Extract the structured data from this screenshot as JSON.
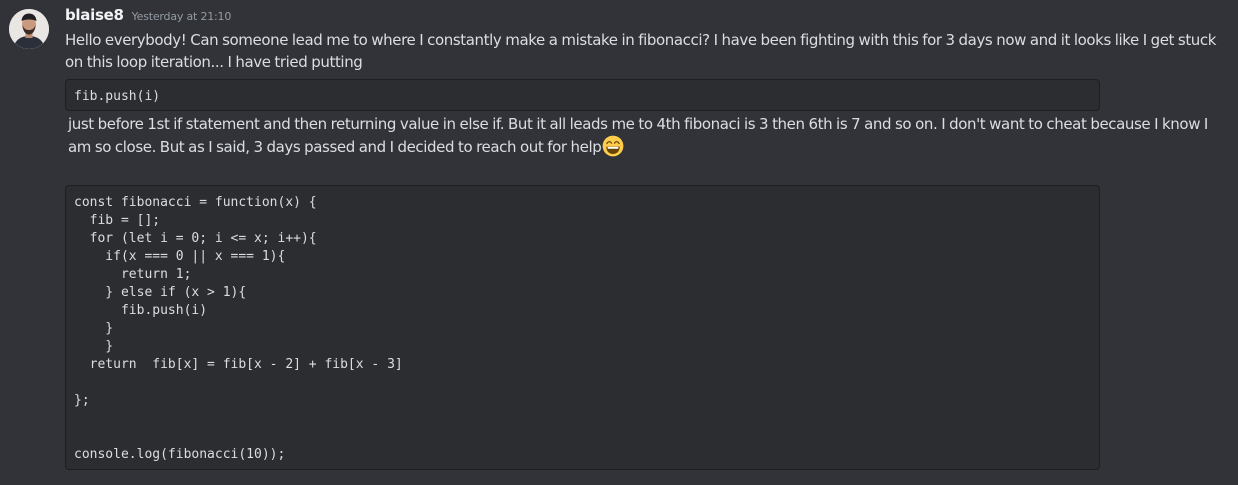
{
  "message": {
    "author": "blaise8",
    "timestamp": "Yesterday at 21:10",
    "text_1": "Hello everybody! Can someone lead me to where I constantly make a mistake in fibonacci? I have been fighting with this for 3 days now and it looks like I get stuck on this loop iteration... I have tried putting",
    "code_snippet": "fib.push(i)",
    "text_2": "just before 1st if statement and then returning value in else if. But it all leads me to 4th fibonaci is 3 then 6th is 7 and so on. I don't want to cheat because I know I am so close. But as I said, 3 days passed and I decided to reach out for help",
    "emoji": "grinning-face-emoji",
    "code_block": "const fibonacci = function(x) {\n  fib = [];\n  for (let i = 0; i <= x; i++){\n    if(x === 0 || x === 1){\n      return 1;\n    } else if (x > 1){\n      fib.push(i)\n    }\n    }\n  return  fib[x] = fib[x - 2] + fib[x - 3]\n\n};\n\n\nconsole.log(fibonacci(10));"
  },
  "colors": {
    "background": "#313338",
    "code_background": "#2b2d31",
    "code_border": "#1e1f22",
    "text": "#dbdee1",
    "username": "#f2f3f5",
    "timestamp": "#949ba4"
  }
}
